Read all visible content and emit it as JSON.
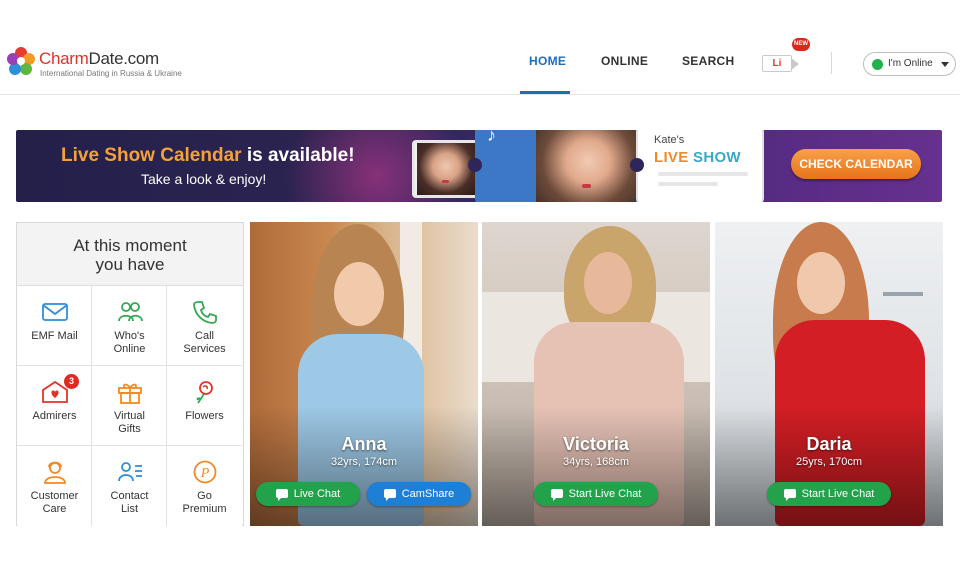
{
  "header": {
    "logo": {
      "name_main": "Charm",
      "name_rest": "Date.com",
      "tagline": "International Dating in Russia & Ukraine"
    },
    "nav": [
      {
        "label": "HOME",
        "active": true
      },
      {
        "label": "ONLINE",
        "active": false
      },
      {
        "label": "SEARCH",
        "active": false
      }
    ],
    "live_icon": {
      "label": "Li",
      "badge": "NEW"
    },
    "status": {
      "label": "I'm Online",
      "color": "#22b24c"
    }
  },
  "banner": {
    "title_highlight": "Live Show Calendar",
    "title_rest": " is available!",
    "subtitle": "Take a look & enjoy!",
    "card_name": "Kate's",
    "card_live": "LIVE",
    "card_show": "SHOW",
    "cta": "CHECK CALENDAR"
  },
  "services": {
    "title": "At this moment\nyou have",
    "items": [
      {
        "label": "EMF Mail",
        "icon": "mail-icon"
      },
      {
        "label": "Who's\nOnline",
        "icon": "people-icon"
      },
      {
        "label": "Call\nServices",
        "icon": "phone-icon"
      },
      {
        "label": "Admirers",
        "icon": "heart-envelope-icon",
        "badge": "3"
      },
      {
        "label": "Virtual\nGifts",
        "icon": "gift-icon"
      },
      {
        "label": "Flowers",
        "icon": "rose-icon"
      },
      {
        "label": "Customer\nCare",
        "icon": "agent-icon"
      },
      {
        "label": "Contact\nList",
        "icon": "contact-list-icon"
      },
      {
        "label": "Go\nPremium",
        "icon": "premium-icon"
      }
    ]
  },
  "profiles": [
    {
      "name": "Anna",
      "meta": "32yrs, 174cm",
      "buttons": [
        "Live Chat",
        "CamShare"
      ]
    },
    {
      "name": "Victoria",
      "meta": "34yrs, 168cm",
      "buttons": [
        "Start Live Chat"
      ]
    },
    {
      "name": "Daria",
      "meta": "25yrs, 170cm",
      "buttons": [
        "Start Live Chat"
      ]
    }
  ],
  "colors": {
    "accent": "#1a70b8",
    "green": "#22a24a",
    "blue": "#1e7fd6",
    "orange": "#f5a13a",
    "badge": "#e02a20"
  }
}
